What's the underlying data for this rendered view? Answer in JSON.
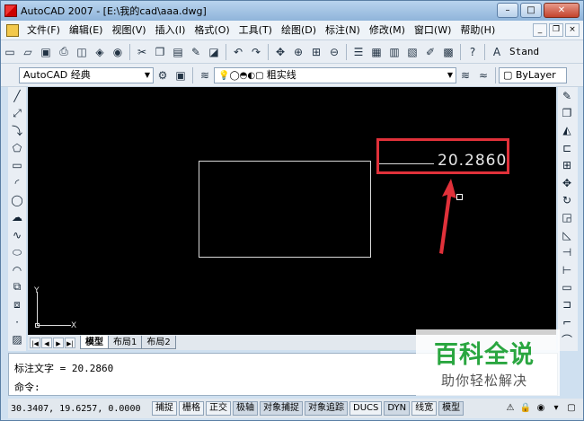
{
  "window": {
    "title": "AutoCAD 2007 - [E:\\我的cad\\aaa.dwg]",
    "buttons": {
      "minimize": "–",
      "maximize": "□",
      "close": "✕"
    }
  },
  "menu": {
    "items": [
      "文件(F)",
      "编辑(E)",
      "视图(V)",
      "插入(I)",
      "格式(O)",
      "工具(T)",
      "绘图(D)",
      "标注(N)",
      "修改(M)",
      "窗口(W)",
      "帮助(H)"
    ],
    "mdi": {
      "minimize": "_",
      "restore": "❐",
      "close": "×"
    }
  },
  "toolbar1": {
    "text_style": "Stand"
  },
  "toolbar2": {
    "workspace": "AutoCAD 经典",
    "layer": "粗实线",
    "color": "ByLayer"
  },
  "drawing": {
    "dimension_text": "20.2860",
    "ucs": {
      "y": "Y",
      "x": "X"
    }
  },
  "layout_tabs": [
    {
      "label": "模型",
      "active": true
    },
    {
      "label": "布局1",
      "active": false
    },
    {
      "label": "布局2",
      "active": false
    }
  ],
  "command": {
    "line1": "标注文字 = 20.2860",
    "line2": "命令:"
  },
  "watermark": {
    "title": "百科全说",
    "subtitle": "助你轻松解决"
  },
  "status": {
    "coords": "30.3407, 19.6257, 0.0000",
    "toggles": [
      "捕捉",
      "栅格",
      "正交",
      "极轴",
      "对象捕捉",
      "对象追踪",
      "DUCS",
      "DYN",
      "线宽",
      "模型"
    ]
  },
  "colors": {
    "dimension_highlight": "#e0313a",
    "canvas": "#000000",
    "watermark": "#2aa640"
  }
}
